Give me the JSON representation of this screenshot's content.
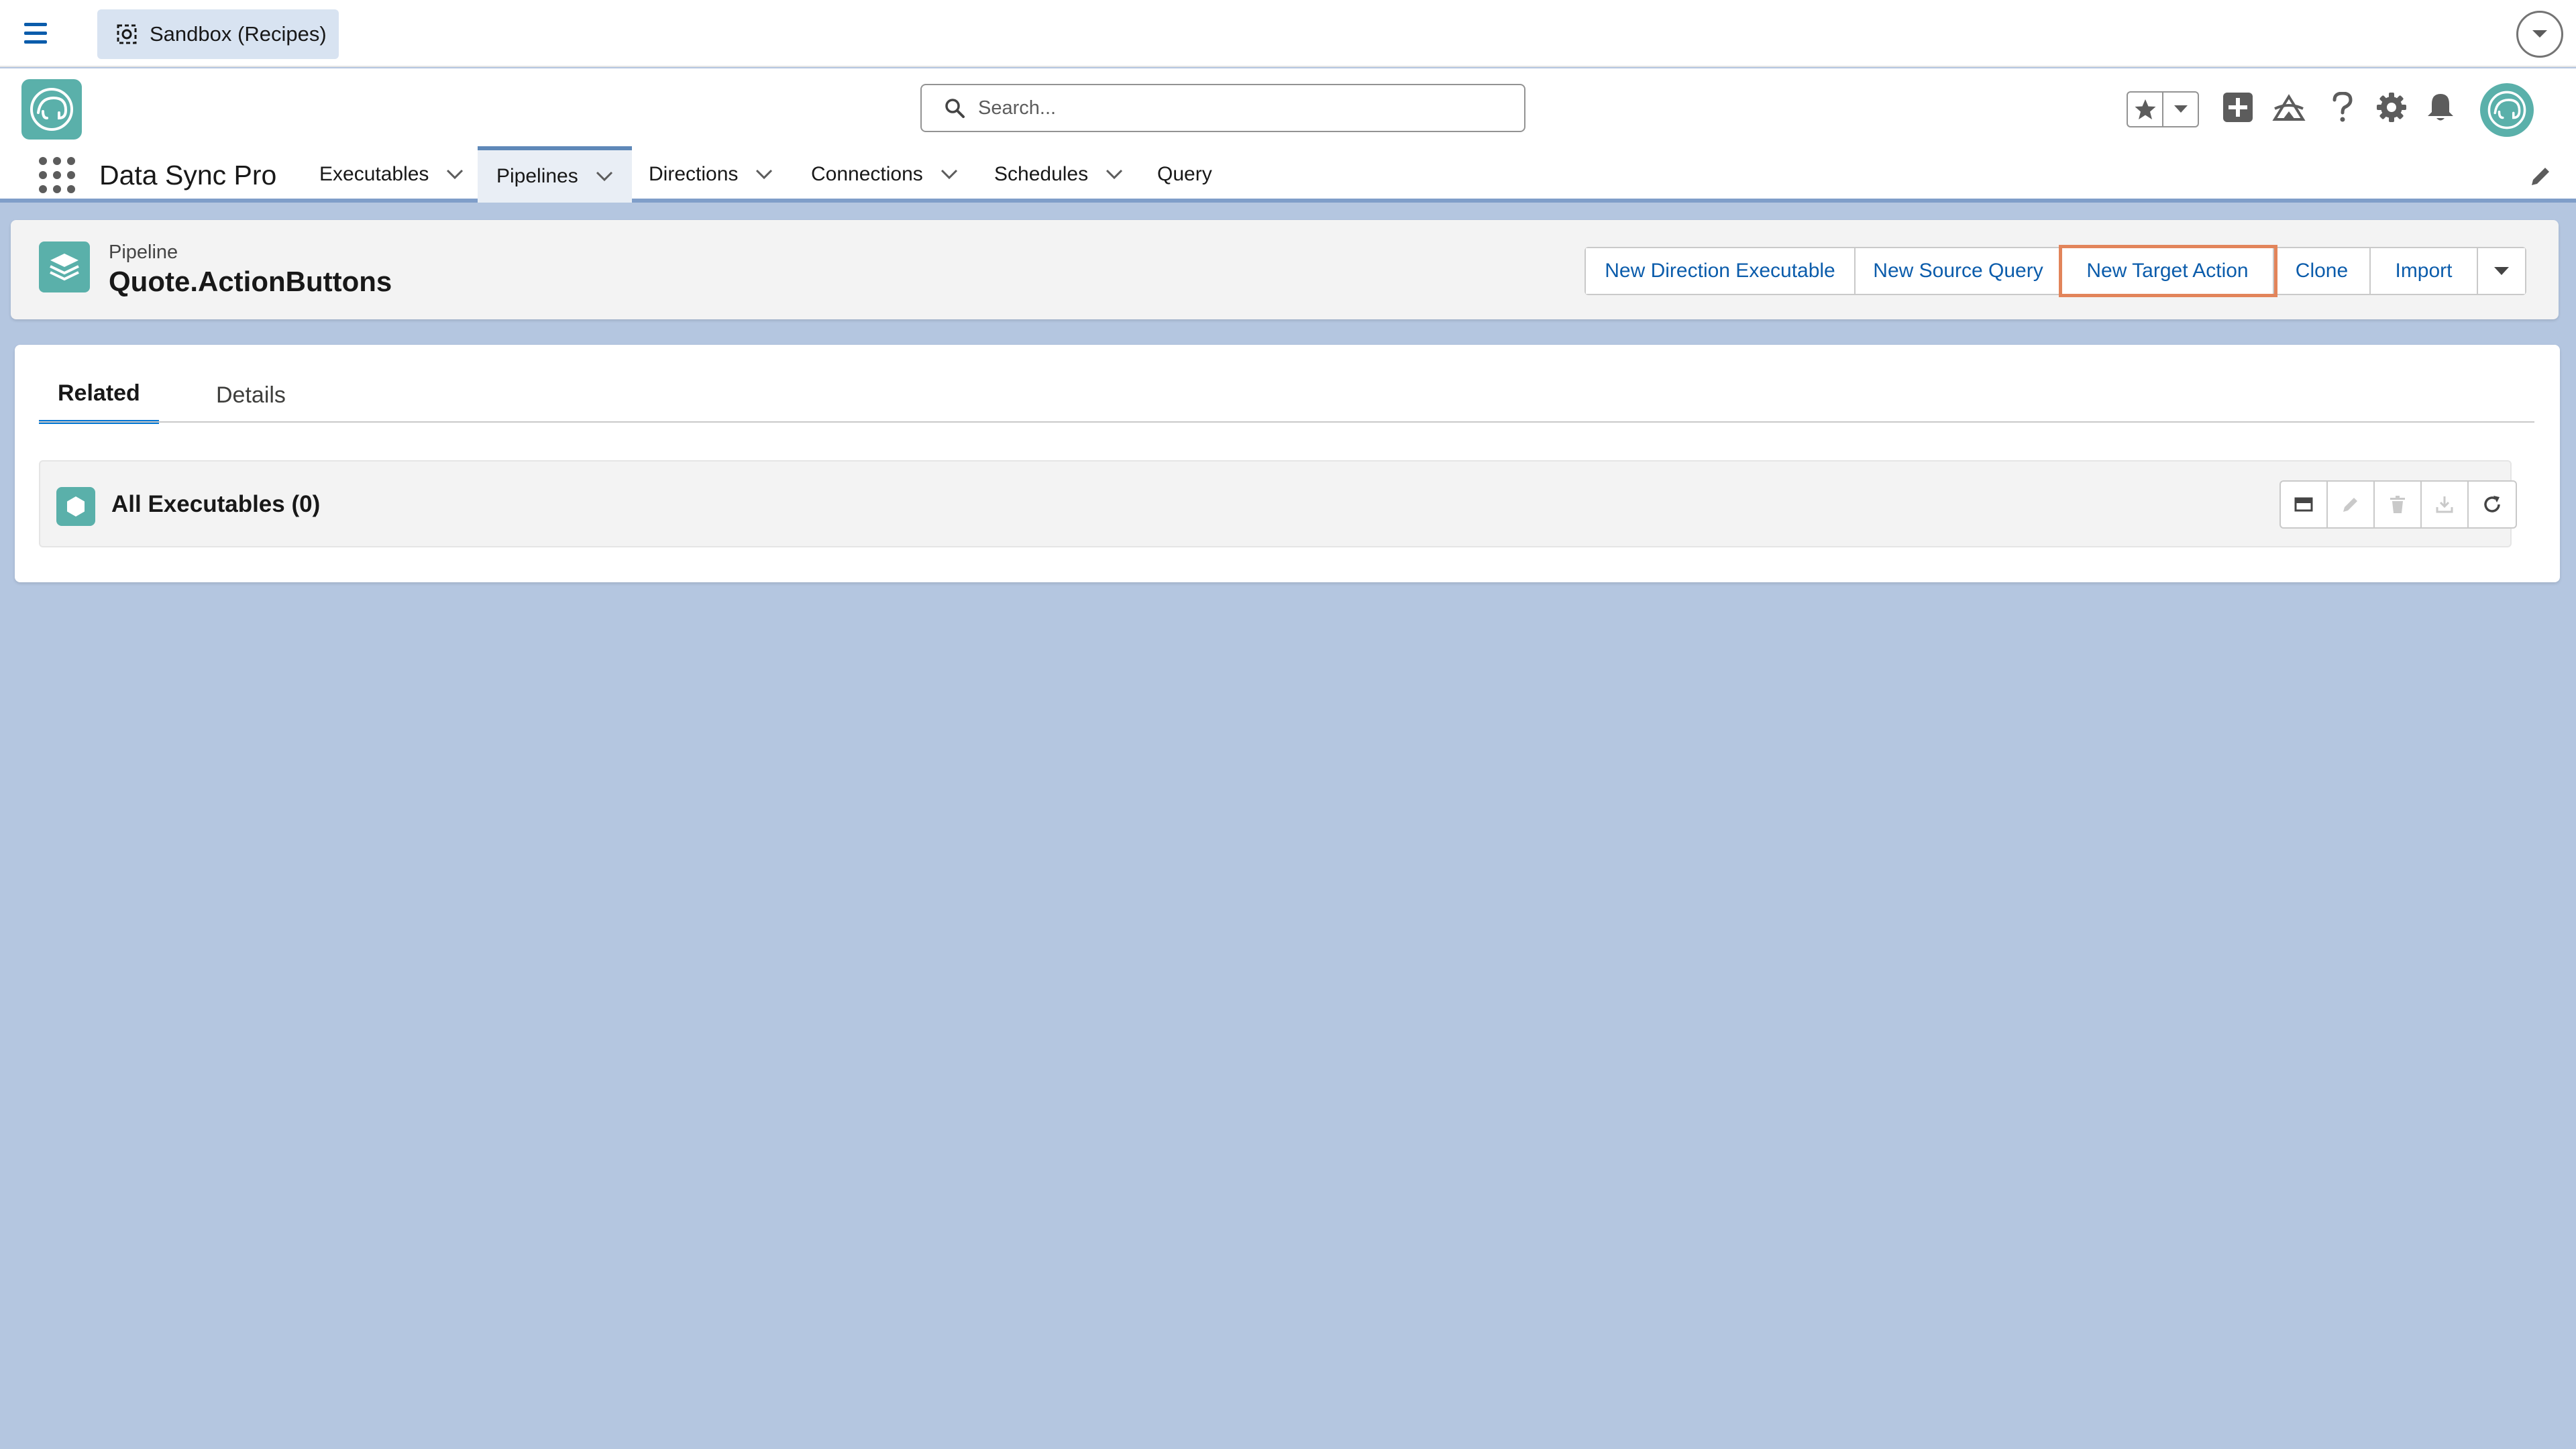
{
  "sandbox": {
    "label": "Sandbox (Recipes)"
  },
  "search": {
    "placeholder": "Search..."
  },
  "app": {
    "name": "Data Sync Pro"
  },
  "nav": {
    "items": [
      {
        "label": "Executables",
        "has_menu": true,
        "active": false
      },
      {
        "label": "Pipelines",
        "has_menu": true,
        "active": true
      },
      {
        "label": "Directions",
        "has_menu": true,
        "active": false
      },
      {
        "label": "Connections",
        "has_menu": true,
        "active": false
      },
      {
        "label": "Schedules",
        "has_menu": true,
        "active": false
      },
      {
        "label": "Query",
        "has_menu": false,
        "active": false
      }
    ]
  },
  "header_icons": [
    "favorites-star-icon",
    "global-actions-add-icon",
    "trailhead-icon",
    "help-icon",
    "setup-gear-icon",
    "notifications-bell-icon"
  ],
  "record": {
    "type": "Pipeline",
    "title": "Quote.ActionButtons",
    "actions": [
      {
        "label": "New Direction Executable"
      },
      {
        "label": "New Source Query"
      },
      {
        "label": "New Target Action",
        "focused": true
      },
      {
        "label": "Clone"
      },
      {
        "label": "Import"
      }
    ]
  },
  "tabs": {
    "related": "Related",
    "details": "Details",
    "selected": "Related"
  },
  "related_list": {
    "title": "All Executables (0)",
    "tools": [
      "table-view-icon",
      "edit-icon",
      "delete-icon",
      "download-icon",
      "refresh-icon"
    ]
  },
  "colors": {
    "brand_teal": "#5ab0aa",
    "link_blue": "#0b5cab",
    "focus_ring": "#e2845a",
    "page_background": "#b4c6e0"
  }
}
